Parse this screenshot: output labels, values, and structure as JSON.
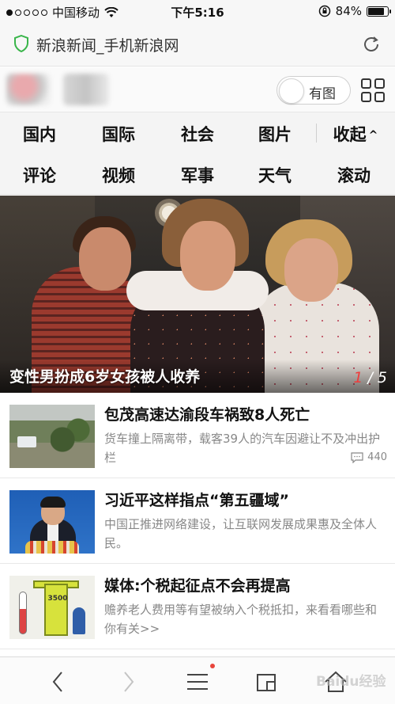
{
  "status_bar": {
    "carrier": "中国移动",
    "time": "下午5:16",
    "battery": "84%",
    "battery_level": 0.84
  },
  "address_bar": {
    "title": "新浪新闻_手机新浪网"
  },
  "brand_row": {
    "toggle_label": "有图"
  },
  "nav": {
    "row1": [
      "国内",
      "国际",
      "社会",
      "图片"
    ],
    "collapse_label": "收起",
    "row2": [
      "评论",
      "视频",
      "军事",
      "天气",
      "滚动"
    ]
  },
  "hero": {
    "caption": "变性男扮成6岁女孩被人收养",
    "current": "1",
    "separator": "/",
    "total": "5"
  },
  "news": [
    {
      "headline": "包茂高速达渝段车祸致8人死亡",
      "summary": "货车撞上隔离带，载客39人的汽车因避让不及冲出护栏",
      "comments": "440"
    },
    {
      "headline": "习近平这样指点“第五疆域”",
      "summary": "中国正推进网络建设，让互联网发展成果惠及全体人民。",
      "comments": ""
    },
    {
      "headline": "媒体:个税起征点不会再提高",
      "summary": "赡养老人费用等有望被纳入个税抵扣，来看看哪些和你有关>>",
      "comments": "",
      "thumb_number": "3500"
    }
  ],
  "watermark": "Baidu经验",
  "colors": {
    "accent_red": "#e8453c",
    "shield_green": "#39b54a"
  }
}
